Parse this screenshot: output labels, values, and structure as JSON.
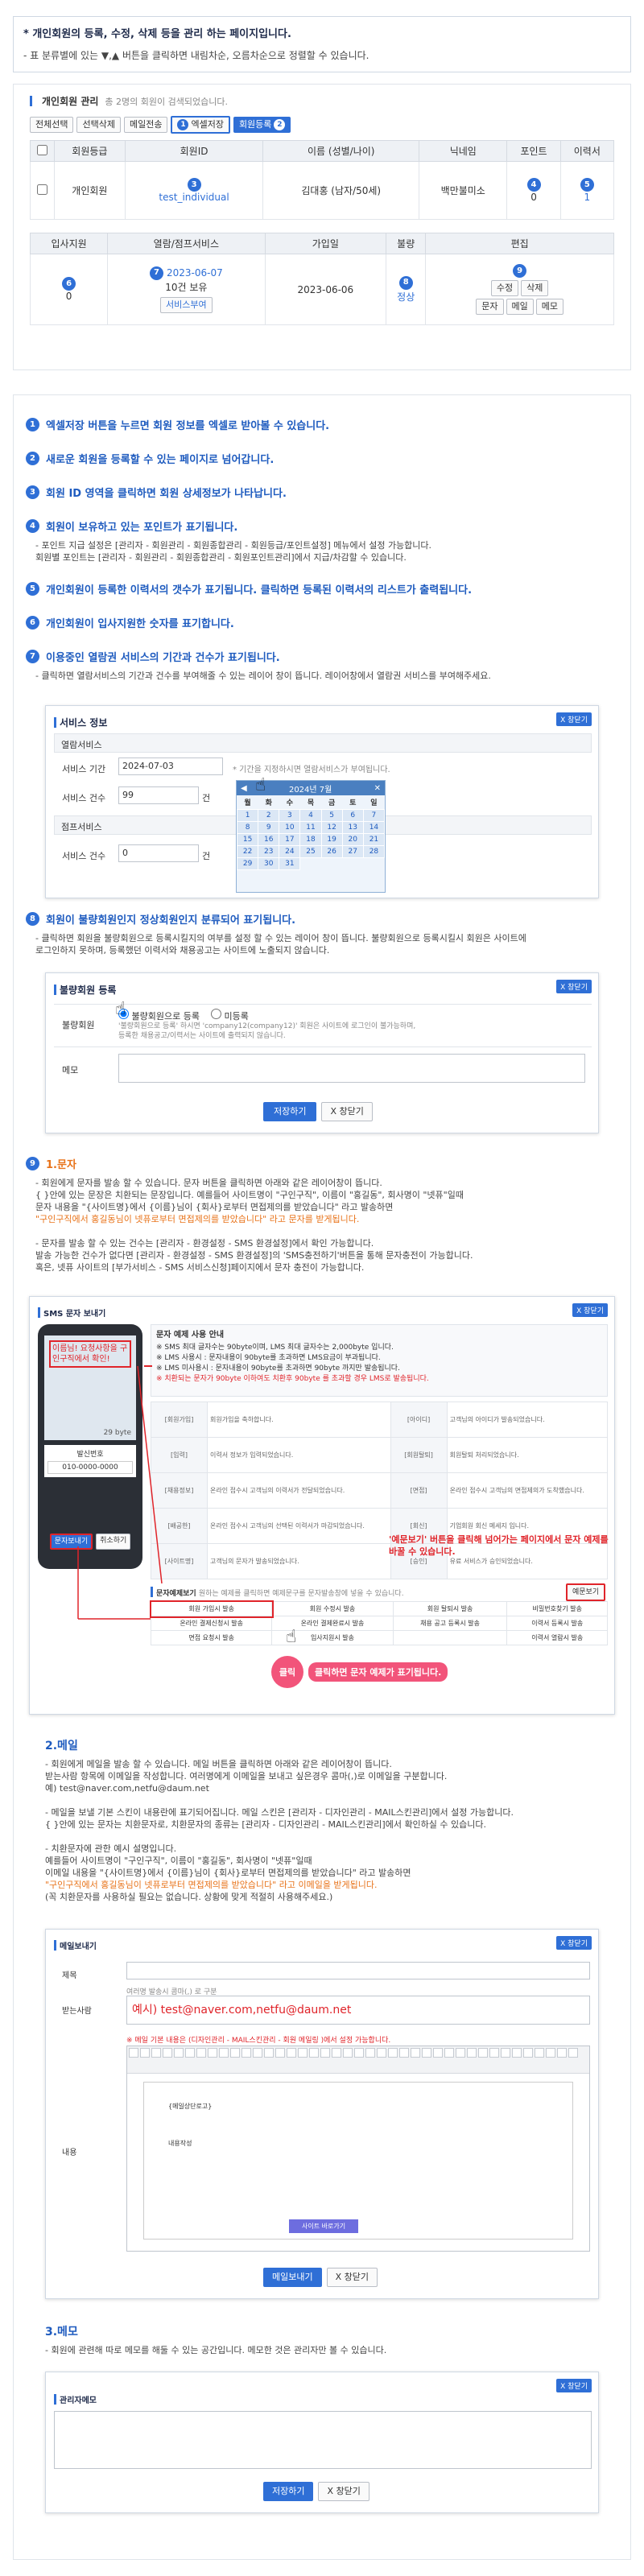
{
  "header": {
    "title": "* 개인회원의 등록, 수정, 삭제 등을 관리 하는 페이지입니다.",
    "desc": "- 표 분류별에 있는 ▼,▲ 버튼을 클릭하면 내림차순, 오름차순으로 정렬할 수 있습니다."
  },
  "member_panel": {
    "title": "개인회원 관리",
    "count_text": "총 2명의 회원이 검색되었습니다.",
    "toolbar": [
      "전체선택",
      "선택삭제",
      "메일전송",
      "엑셀저장",
      "회원등록"
    ],
    "cols1": [
      "회원등급",
      "회원ID",
      "이름 (성별/나이)",
      "닉네임",
      "포인트",
      "이력서"
    ],
    "row1": {
      "grade": "개인회원",
      "id": "test_individual",
      "name": "김대홍 (남자/50세)",
      "nick": "백만불미소",
      "point": "0",
      "resume": "1"
    },
    "cols2": [
      "입사지원",
      "열람/점프서비스",
      "가입일",
      "불량",
      "편집"
    ],
    "row2": {
      "apply": "0",
      "service_date": "2023-06-07",
      "service_count": "10건 보유",
      "service_btn": "서비스부여",
      "join": "2023-06-06",
      "bad": "정상",
      "edit": [
        "수정",
        "삭제"
      ],
      "edit2": [
        "문자",
        "메일",
        "메모"
      ]
    },
    "markers": [
      "1",
      "2",
      "3",
      "4",
      "5",
      "6",
      "7",
      "8",
      "9"
    ]
  },
  "steps": [
    {
      "n": "1",
      "text": "엑셀저장 버튼을 누르면 회원 정보를 엑셀로 받아볼 수 있습니다."
    },
    {
      "n": "2",
      "text": "새로운 회원을 등록할 수 있는 페이지로 넘어갑니다."
    },
    {
      "n": "3",
      "text": "회원 ID 영역을 클릭하면 회원 상세정보가 나타납니다."
    },
    {
      "n": "4",
      "text": "회원이 보유하고 있는 포인트가 표기됩니다."
    },
    {
      "n": "5",
      "text": "개인회원이 등록한 이력서의 갯수가 표기됩니다. 클릭하면 등록된 이력서의 리스트가 출력됩니다."
    },
    {
      "n": "6",
      "text": "개인회원이 입사지원한 숫자를 표기합니다."
    },
    {
      "n": "7",
      "text": "이용중인 열람권 서비스의 기간과 건수가 표기됩니다."
    },
    {
      "n": "8",
      "text": "회원이 불량회원인지 정상회원인지 분류되어 표기됩니다."
    },
    {
      "n": "9",
      "text": "1.문자"
    }
  ],
  "step4_notes": [
    "- 포인트 지급 설정은 [관리자 - 회원관리 - 회원종합관리 - 회원등급/포인트설정] 메뉴에서 설정 가능합니다.",
    "회원별 포인트는 [관리자 - 회원관리 - 회원종합관리 - 회원포인트관리]에서 지급/차감할 수 있습니다."
  ],
  "step7_note": "- 클릭하면 열람서비스의 기간과 건수를 부여해줄 수 있는 레이어 창이 뜹니다. 레이어창에서 열람권 서비스를 부여해주세요.",
  "service_layer": {
    "close": "X 창닫기",
    "title": "서비스 정보",
    "sec1": "열람서비스",
    "period_lbl": "서비스 기간",
    "period_val": "2024-07-03",
    "period_hint": "* 기간을 지정하시면 열람서비스가 부여됩니다.",
    "count_lbl": "서비스 건수",
    "count_val": "99",
    "unit": "건",
    "sec2": "점프서비스",
    "count2_lbl": "서비스 건수",
    "count2_val": "0",
    "cal_title": "2024년 7월",
    "cal_days": [
      "월",
      "화",
      "수",
      "목",
      "금",
      "토",
      "일"
    ],
    "cal_weeks": [
      [
        "1",
        "2",
        "3",
        "4",
        "5",
        "6",
        "7"
      ],
      [
        "8",
        "9",
        "10",
        "11",
        "12",
        "13",
        "14"
      ],
      [
        "15",
        "16",
        "17",
        "18",
        "19",
        "20",
        "21"
      ],
      [
        "22",
        "23",
        "24",
        "25",
        "26",
        "27",
        "28"
      ],
      [
        "29",
        "30",
        "31",
        "",
        "",
        "",
        ""
      ]
    ]
  },
  "step8_notes": [
    "- 클릭하면 회원을 불량회원으로 등록시킬지의 여부를 설정 할 수 있는 레이어 창이 뜹니다. 불량회원으로 등록시킬시 회원은 사이트에",
    "로그인하지 못하며, 등록했던 이력서와 채용공고는 사이트에 노출되지 않습니다."
  ],
  "bad_layer": {
    "close": "X 창닫기",
    "title": "불량회원 등록",
    "lbl": "불량회원",
    "opt1": "불량회원으로 등록",
    "opt2": "미등록",
    "hint": "'불량회원으로 등록' 하시면 'company12(company12)' 회원은 사이트에 로그인이 불가능하며, 등록한 채용공고/이력서는 사이트에 출력되지 않습니다.",
    "memo_lbl": "메모",
    "save": "저장하기",
    "cancel": "X 창닫기"
  },
  "sms_notes": [
    "- 회원에게 문자를 발송 할 수 있습니다. 문자 버튼을 클릭하면 아래와 같은 레이어창이 뜹니다.",
    "{ }안에 있는 문장은 치환되는 문장입니다. 예를들어 사이트명이 \"구인구직\", 이름이 \"홍길동\", 회사명이 \"넷퓨\"일때",
    "문자 내용을 \"{사이트명}에서 {이름}님이 {회사}로부터 면접제의를 받았습니다\" 라고 발송하면",
    "\"구인구직에서 홍길동님이 넷퓨로부터 면접제의를 받았습니다\" 라고 문자를 받게됩니다.",
    "",
    "- 문자를 발송 할 수 있는 건수는 [관리자 - 환경설정 - SMS 환경설정]에서 확인 가능합니다.",
    "발송 가능한 건수가 없다면 [관리자 - 환경설정 - SMS 환경설정]의 'SMS충전하기'버튼을 통해 문자충전이 가능합니다.",
    "혹은, 넷퓨 사이트의 [부가서비스 - SMS 서비스신청]페이지에서 문자 충전이 가능합니다."
  ],
  "sms_layer": {
    "close": "X 창닫기",
    "title": "SMS 문자 보내기",
    "guide_title": "문자 예제 사용 안내",
    "guide_lines": [
      "※ SMS 최대 글자수는 90byte이며, LMS 최대 글자수는 2,000byte 입니다.",
      "※ LMS 사용시 : 문자내용이 90byte를 초과하면 LMS요금이 부과됩니다.",
      "※ LMS 미사용시 : 문자내용이 90byte를 초과하면 90byte 까지만 발송됩니다."
    ],
    "guide_red": "※ 치환되는 문자가 90byte 이하여도 치환후 90byte 를 초과할 경우 LMS로 발송됩니다.",
    "phone_msg": "이름님! 요청사항을 구인구직에서 확인!",
    "phone_sender_lbl": "발신번호",
    "phone_sender": "010-0000-0000",
    "phone_btns": [
      "문자보내기",
      "취소하기"
    ],
    "phone_bytes": "29 byte",
    "table_rows": [
      [
        "[회원가입]",
        "회원가입을 축하합니다.",
        "[아이디]",
        "고객님의 아이디가 발송되었습니다."
      ],
      [
        "[입력]",
        "이력서 정보가 입력되었습니다.",
        "[회원탈퇴]",
        "회원탈퇴 처리되었습니다."
      ],
      [
        "[채용정보]",
        "온라인 접수시 고객님의 이력서가 전달되었습니다.",
        "[면접]",
        "온라인 접수시 고객님의 면접제의가 도착했습니다."
      ],
      [
        "[배공한]",
        "온라인 접수시 고객님의 선택된 이력서가 마감되었습니다.",
        "[회신]",
        "기업회원 회신 메세지 입니다."
      ],
      [
        "[사이트명]",
        "고객님의 문자가 발송되었습니다.",
        "[승인]",
        "유료 서비스가 승인되었습니다."
      ]
    ],
    "example_title": "문자예제보기",
    "example_hint": "원하는 예제를 클릭하면 예제문구를 문자발송창에 넣을 수 있습니다.",
    "example_btn": "예문보기",
    "example_cells": [
      "회원 가입시 발송",
      "회원 수정시 발송",
      "회원 탈퇴시 발송",
      "비밀번호찾기 발송",
      "온라인 결제신청시 발송",
      "온라인 결제완료시 발송",
      "채용 공고 등록시 발송",
      "이력서 등록시 발송",
      "면접 요청시 발송",
      "입사지원시 발송",
      "",
      "이력서 열람시 발송"
    ],
    "callout1": "'예문보기' 버튼을 클릭해 넘어가는 페이지에서 문자 예제를 바꿀 수 있습니다.",
    "callout2": "클릭하면 문자 예제가 표기됩니다.",
    "click_lbl": "클릭"
  },
  "mail_section": {
    "title": "2.메일",
    "notes": [
      "- 회원에게 메일을 발송 할 수 있습니다. 메일 버튼을 클릭하면 아래와 같은 레이어창이 뜹니다.",
      "받는사람 항목에 이메일을 작성합니다. 여러명에게 이메일을 보내고 싶은경우 콤마(,)로 이메일을 구분합니다.",
      "예) test@naver.com,netfu@daum.net",
      "",
      "- 메일을 보낼 기본 스킨이 내용란에 표기되어집니다. 메일 스킨은 [관리자 - 디자인관리 - MAIL스킨관리]에서 설정 가능합니다.",
      "{ }안에 있는 문자는 치환문자로, 치환문자의 종류는 [관리자 - 디자인관리 - MAIL스킨관리]에서 확인하실 수 있습니다.",
      "",
      "- 치환문자에 관한 예시 설명입니다.",
      "예를들어 사이트명이 \"구인구직\", 이름이 \"홍길동\", 회사명이 \"넷퓨\"일때",
      "이메일 내용을 \"{사이트명}에서 {이름}님이 {회사}로부터 면접제의를 받았습니다\" 라고 발송하면",
      "\"구인구직에서 홍길동님이 넷퓨로부터 면접제의를 받았습니다\" 라고 이메일을 받게됩니다.",
      "(꼭 치환문자를 사용하실 필요는 없습니다. 상황에 맞게 적절히 사용해주세요.)"
    ]
  },
  "mail_layer": {
    "close": "X 창닫기",
    "title": "메일보내기",
    "subject_lbl": "제목",
    "to_lbl": "받는사람",
    "to_hint": "여러명 발송시 콤마(,) 로 구분",
    "to_example": "예시) test@naver.com,netfu@daum.net",
    "body_lbl": "내용",
    "body_hint": "※ 메일 기본 내용은 (디자인관리 - MAIL스킨관리 - 회원 메일링 )에서 설정 가능합니다.",
    "body_line1": "{메일상단로고}",
    "body_line2": "내용작성",
    "body_btn": "사이트 바로가기",
    "send": "메일보내기",
    "cancel": "X 창닫기"
  },
  "memo_section": {
    "title": "3.메모",
    "note": "- 회원에 관련해 따로 메모를 해둘 수 있는 공간입니다. 메모한 것은 관리자만 볼 수 있습니다."
  },
  "memo_layer": {
    "close": "X 창닫기",
    "title": "관리자메모",
    "save": "저장하기",
    "cancel": "X 창닫기"
  }
}
